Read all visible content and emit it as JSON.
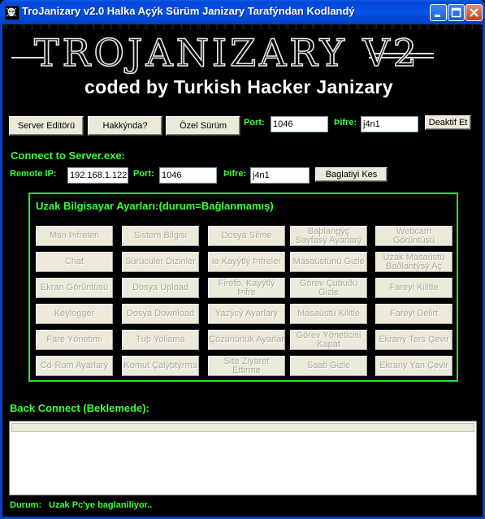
{
  "window": {
    "title": "TroJanizary v2.0 Halka Açýk Sürüm Janizary Tarafýndan Kodlandý"
  },
  "banner": {
    "logo": "TROJANIZARY V2",
    "subtitle": "coded by Turkish Hacker Janizary"
  },
  "toolbar": {
    "server_editor": "Server Editörü",
    "about": "Hakkýnda?",
    "special": "Özel Sürüm",
    "port_label": "Port:",
    "port_value": "1046",
    "password_label": "Þifre:",
    "password_value": "j4n1",
    "deactivate": "Deaktif Et"
  },
  "connect": {
    "heading": "Connect to Server.exe:",
    "ip_label": "Remote IP:",
    "ip_value": "192.168.1.122",
    "port_label": "Port:",
    "port_value": "1046",
    "password_label": "Þifre:",
    "password_value": "j4n1",
    "disconnect": "Baglatiyi Kes"
  },
  "remote_settings": {
    "title": "Uzak Bilgisayar Ayarları:(durum=Bağlanmamış)",
    "rows": [
      [
        "Msn Þifreleri",
        "Sistem Bilgisi",
        "Dosya Silme",
        "Baþlangýç Sayfasý Ayarlarý",
        "Webcam Görüntüsü"
      ],
      [
        "Chat",
        "Sürücüler Dizinler",
        "ie Kayýtlý Þifreler",
        "Masaüstünü Gizle",
        "Uzak Masaüstü Baðlantýsý Aç"
      ],
      [
        "Ekran Görüntüsü",
        "Dosya Upload",
        "Firefo. Kayýtlý Þifre",
        "Görev Çubuðu Gizle",
        "Fareyi Kilitle"
      ],
      [
        "Keylogger",
        "Dosya Download",
        "Yazýcý Ayarlarý",
        "Masaüstü Kilitle",
        "Fareyi Delirt"
      ],
      [
        "Fare Yönetimi",
        "Tuþ Yollama",
        "Çözünürlük Ayarlar",
        "Görev Yöneticisi Kapat",
        "Ekraný Ters Çevir"
      ],
      [
        "Cd-Rom Ayarlarý",
        "Komut Çalýþtýrma",
        "Site Ziyaret Ettirme",
        "Saati Gizle",
        "Ekraný Yan Çevir"
      ]
    ]
  },
  "back_connect": {
    "heading": "Back Connect (Beklemede):"
  },
  "status": {
    "label": "Durum:",
    "value": "Uzak Pc'ye baglaniliyor.."
  }
}
